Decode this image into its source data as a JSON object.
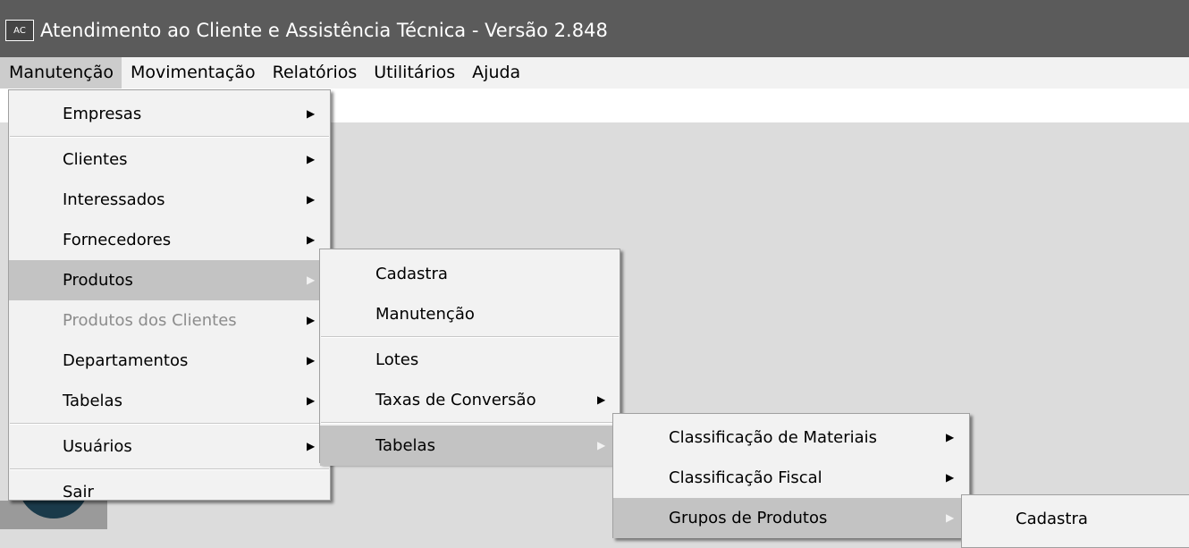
{
  "window": {
    "icon_text": "AC",
    "title": "Atendimento ao Cliente e Assistência Técnica - Versão 2.848"
  },
  "menubar": {
    "items": [
      "Manutenção",
      "Movimentação",
      "Relatórios",
      "Utilitários",
      "Ajuda"
    ]
  },
  "menu_manutencao": {
    "empresas": "Empresas",
    "clientes": "Clientes",
    "interessados": "Interessados",
    "fornecedores": "Fornecedores",
    "produtos": "Produtos",
    "produtos_dos_clientes": "Produtos dos Clientes",
    "departamentos": "Departamentos",
    "tabelas": "Tabelas",
    "usuarios": "Usuários",
    "sair": "Sair"
  },
  "menu_produtos": {
    "cadastra": "Cadastra",
    "manutencao": "Manutenção",
    "lotes": "Lotes",
    "taxas": "Taxas de Conversão",
    "tabelas": "Tabelas"
  },
  "menu_tabelas": {
    "classificacao_materiais": "Classificação de Materiais",
    "classificacao_fiscal": "Classificação Fiscal",
    "grupos_produtos": "Grupos de Produtos"
  },
  "menu_grupos": {
    "cadastra": "Cadastra"
  },
  "arrow_glyph": "▶"
}
